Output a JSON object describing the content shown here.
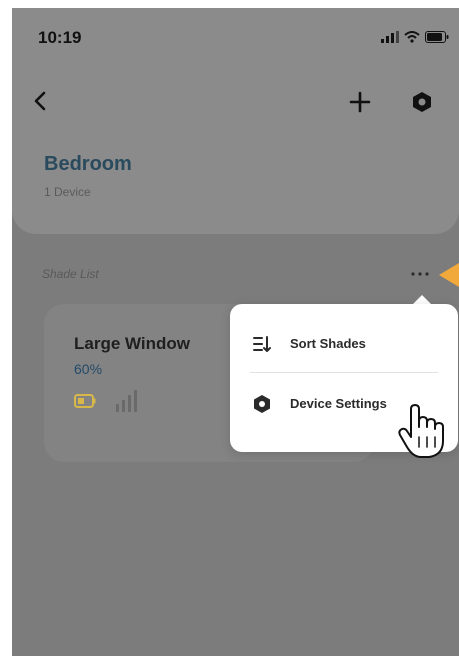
{
  "status_bar": {
    "time": "10:19",
    "icons": [
      "signal-icon",
      "wifi-icon",
      "battery-icon"
    ]
  },
  "nav": {
    "back_icon": "chevron-left-icon",
    "add_icon": "plus-icon",
    "settings_icon": "hexagon-gear-icon"
  },
  "room": {
    "title": "Bedroom",
    "subtitle": "1 Device"
  },
  "shade_list": {
    "label": "Shade List",
    "more_icon": "ellipsis-icon",
    "shades": [
      {
        "name": "Large Window",
        "position": "60%",
        "battery_icon": "battery-icon",
        "signal_icon": "signal-strength-icon"
      }
    ]
  },
  "menu": {
    "items": [
      {
        "label": "Sort Shades",
        "icon": "sort-icon"
      },
      {
        "label": "Device Settings",
        "icon": "hexagon-gear-icon"
      }
    ]
  },
  "colors": {
    "overlay_bg": "#7c7c7c",
    "header_bg": "#8b8b8b",
    "title": "#2a4a5e",
    "percent": "#234a69",
    "battery": "#d9b84a",
    "pointer": "#f2a93b",
    "menu_bg": "#ffffff"
  }
}
